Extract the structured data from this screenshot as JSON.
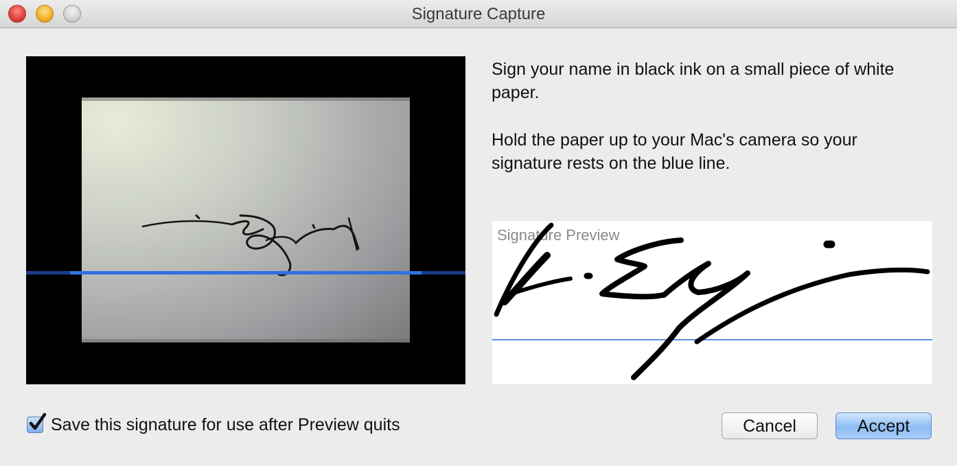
{
  "window": {
    "title": "Signature Capture"
  },
  "instructions": {
    "line1": "Sign your name in black ink on a small piece of white paper.",
    "line2": "Hold the paper up to your Mac's camera so your signature rests on the blue line."
  },
  "preview": {
    "label": "Signature Preview"
  },
  "options": {
    "save_label": "Save this signature for use after Preview quits",
    "save_checked": true
  },
  "buttons": {
    "cancel": "Cancel",
    "accept": "Accept"
  },
  "colors": {
    "guide_line": "#2f72e0",
    "accept_button": "#8cbcf3"
  },
  "icons": [
    "close-window-icon",
    "minimize-window-icon",
    "zoom-window-icon",
    "checkmark-icon"
  ]
}
